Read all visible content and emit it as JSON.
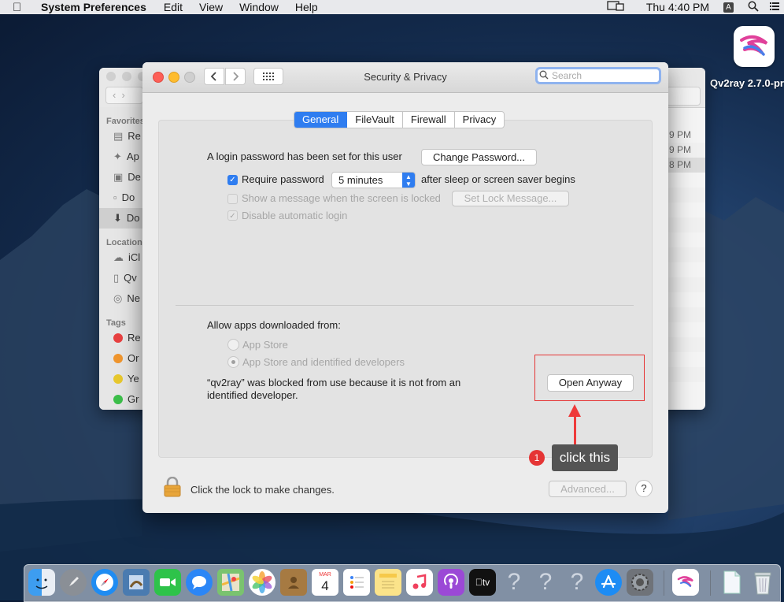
{
  "menubar": {
    "app": "System Preferences",
    "items": [
      "Edit",
      "View",
      "Window",
      "Help"
    ],
    "clock": "Thu 4:40 PM",
    "input_indicator": "A"
  },
  "desktop": {
    "app_label": "Qv2ray 2.7.0-pr"
  },
  "finder": {
    "sidebar": {
      "favorites_header": "Favorites",
      "favorites": [
        "Re",
        "Ap",
        "De",
        "Do",
        "Do"
      ],
      "locations_header": "Location",
      "locations": [
        "iCl",
        "Qv",
        "Ne"
      ],
      "tags_header": "Tags",
      "tags": [
        "Re",
        "Or",
        "Ye",
        "Gr"
      ]
    },
    "times": [
      "9 PM",
      "9 PM",
      "8 PM"
    ]
  },
  "window": {
    "title": "Security & Privacy",
    "search_placeholder": "Search",
    "tabs": [
      "General",
      "FileVault",
      "Firewall",
      "Privacy"
    ],
    "active_tab": "General"
  },
  "general": {
    "login_text": "A login password has been set for this user",
    "change_password": "Change Password...",
    "require_password_label": "Require password",
    "require_password_value": "5 minutes",
    "after_sleep": "after sleep or screen saver begins",
    "show_message": "Show a message when the screen is locked",
    "set_lock_message": "Set Lock Message...",
    "disable_auto_login": "Disable automatic login",
    "allow_apps_header": "Allow apps downloaded from:",
    "option_app_store": "App Store",
    "option_identified": "App Store and identified developers",
    "blocked_line1": "“qv2ray” was blocked from use because it is not from an",
    "blocked_line2": "identified developer.",
    "open_anyway": "Open Anyway"
  },
  "annotation": {
    "badge": "1",
    "tooltip": "click this"
  },
  "footer": {
    "lock_text": "Click the lock to make changes.",
    "advanced": "Advanced...",
    "help": "?"
  },
  "dock": {
    "calendar_month": "MAR",
    "calendar_day": "4",
    "tv_label": "tv"
  },
  "colors": {
    "accent": "#2f7df0",
    "annotation_red": "#e53535"
  }
}
